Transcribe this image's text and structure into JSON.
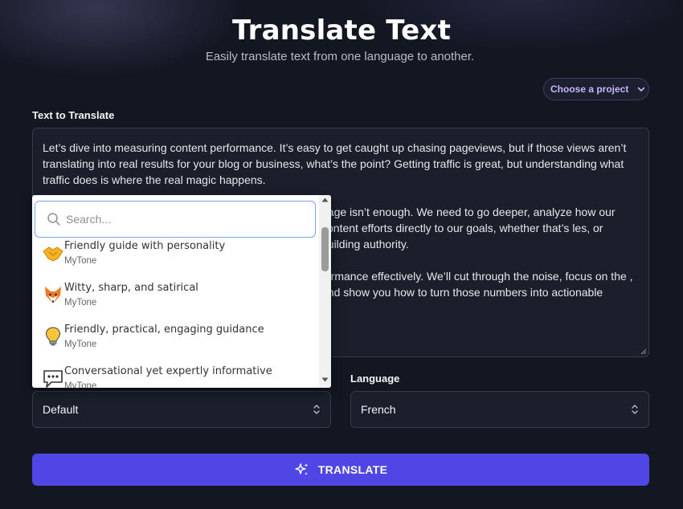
{
  "header": {
    "title": "Translate Text",
    "subtitle": "Easily translate text from one language to another."
  },
  "project": {
    "label": "Choose a project"
  },
  "text_section": {
    "label": "Text to Translate",
    "paragraphs": [
      "Let’s dive into measuring content performance. It’s easy to get caught up chasing pageviews, but if those views aren’t translating into real results for your blog or business, what’s the point? Getting traffic is great, but understanding what traffic does is where the real magic happens.",
      "page isn’t enough. We need to go deeper, analyze how our content efforts directly to our goals, whether that’s les, or building authority.",
      "formance effectively. We’ll cut through the noise, focus on the , and show you how to turn those numbers into actionable"
    ]
  },
  "tone_dropdown": {
    "search_placeholder": "Search...",
    "items": [
      {
        "name": "Friendly guide with personality",
        "source": "MyTone",
        "icon": "handshake-icon"
      },
      {
        "name": "Witty, sharp, and satirical",
        "source": "MyTone",
        "icon": "fox-icon"
      },
      {
        "name": "Friendly, practical, engaging guidance",
        "source": "MyTone",
        "icon": "lightbulb-icon"
      },
      {
        "name": "Conversational yet expertly informative",
        "source": "MyTone",
        "icon": "speech-bubble-icon"
      }
    ],
    "selected": "Default"
  },
  "language": {
    "label": "Language",
    "selected": "French"
  },
  "translate_button": {
    "label": "TRANSLATE"
  },
  "colors": {
    "accent": "#4f46e5",
    "background": "#131722",
    "project_text": "#c4b5fd"
  }
}
